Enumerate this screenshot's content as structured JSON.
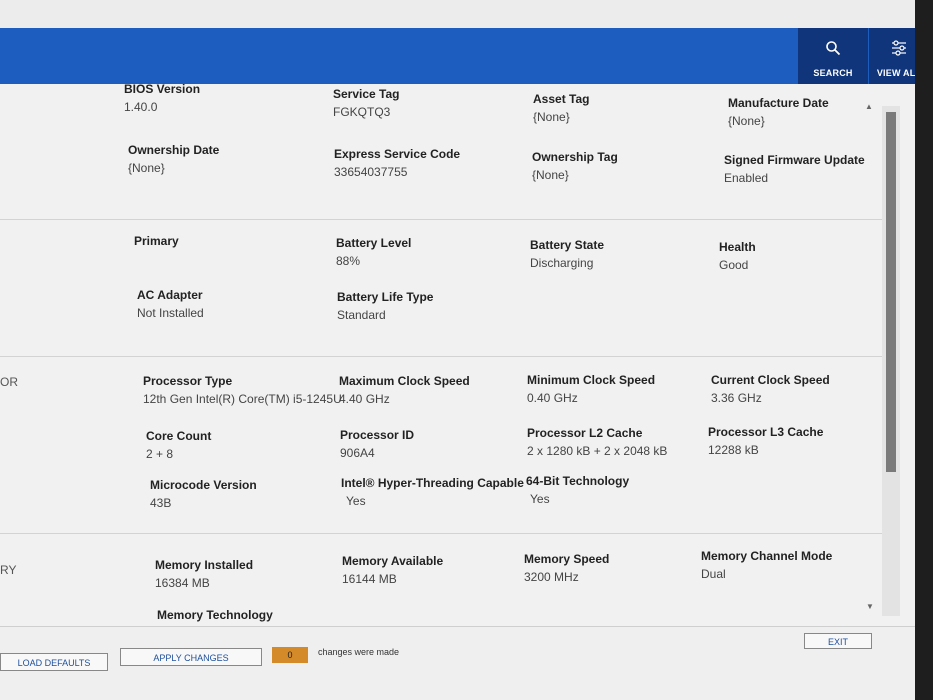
{
  "header": {
    "search_label": "SEARCH",
    "viewall_label": "VIEW ALL"
  },
  "system": {
    "bios_version": {
      "label": "BIOS Version",
      "value": "1.40.0"
    },
    "service_tag": {
      "label": "Service Tag",
      "value": "FGKQTQ3"
    },
    "asset_tag": {
      "label": "Asset Tag",
      "value": "{None}"
    },
    "manufacture_date": {
      "label": "Manufacture Date",
      "value": "{None}"
    },
    "ownership_date": {
      "label": "Ownership Date",
      "value": "{None}"
    },
    "express_service_code": {
      "label": "Express Service Code",
      "value": "33654037755"
    },
    "ownership_tag": {
      "label": "Ownership Tag",
      "value": "{None}"
    },
    "signed_firmware": {
      "label": "Signed Firmware Update",
      "value": "Enabled"
    }
  },
  "battery": {
    "primary": {
      "label": "Primary"
    },
    "level": {
      "label": "Battery Level",
      "value": "88%"
    },
    "state": {
      "label": "Battery State",
      "value": "Discharging"
    },
    "health": {
      "label": "Health",
      "value": "Good"
    },
    "ac_adapter": {
      "label": "AC Adapter",
      "value": "Not Installed"
    },
    "life_type": {
      "label": "Battery Life Type",
      "value": "Standard"
    }
  },
  "processor": {
    "side_label": "OR",
    "type": {
      "label": "Processor Type",
      "value": "12th Gen Intel(R) Core(TM) i5-1245U"
    },
    "max_clock": {
      "label": "Maximum Clock Speed",
      "value": "4.40 GHz"
    },
    "min_clock": {
      "label": "Minimum Clock Speed",
      "value": "0.40 GHz"
    },
    "cur_clock": {
      "label": "Current Clock Speed",
      "value": "3.36 GHz"
    },
    "core_count": {
      "label": "Core Count",
      "value": "2 + 8"
    },
    "id": {
      "label": "Processor ID",
      "value": "906A4"
    },
    "l2": {
      "label": "Processor L2 Cache",
      "value": "2 x 1280  kB + 2 x 2048  kB"
    },
    "l3": {
      "label": "Processor L3 Cache",
      "value": "12288 kB"
    },
    "microcode": {
      "label": "Microcode Version",
      "value": "43B"
    },
    "ht": {
      "label": "Intel® Hyper-Threading Capable",
      "value": "Yes"
    },
    "x64": {
      "label": "64-Bit Technology",
      "value": "Yes"
    }
  },
  "memory": {
    "side_label": "RY",
    "installed": {
      "label": "Memory Installed",
      "value": "16384 MB"
    },
    "available": {
      "label": "Memory Available",
      "value": "16144 MB"
    },
    "speed": {
      "label": "Memory Speed",
      "value": "3200 MHz"
    },
    "channel": {
      "label": "Memory Channel Mode",
      "value": "Dual"
    },
    "technology": {
      "label": "Memory Technology"
    }
  },
  "footer": {
    "load_defaults": "LOAD DEFAULTS",
    "apply_changes": "APPLY CHANGES",
    "changes_count": "0",
    "changes_text": "changes were made",
    "exit": "EXIT"
  }
}
